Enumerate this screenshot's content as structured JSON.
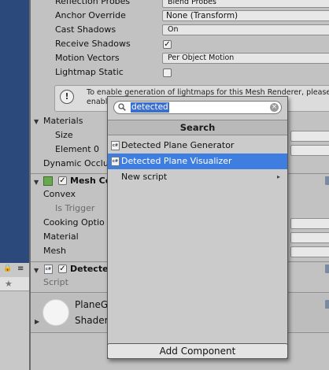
{
  "inspector": {
    "props": {
      "reflection_probes_label": "Reflection Probes",
      "reflection_probes_value": "Blend Probes",
      "anchor_override_label": "Anchor Override",
      "anchor_override_value": "None (Transform)",
      "cast_shadows_label": "Cast Shadows",
      "cast_shadows_value": "On",
      "receive_shadows_label": "Receive Shadows",
      "receive_shadows_mark": "✓",
      "motion_vectors_label": "Motion Vectors",
      "motion_vectors_value": "Per Object Motion",
      "lightmap_static_label": "Lightmap Static"
    },
    "info_text": "To enable generation of lightmaps for this Mesh Renderer, please enable",
    "materials": {
      "header": "Materials",
      "size_label": "Size",
      "element0_label": "Element 0"
    },
    "dynamic_occlusion_label": "Dynamic Occlu",
    "mesh_collider": {
      "title": "Mesh Co",
      "check_mark": "✓",
      "convex_label": "Convex",
      "is_trigger_label": "Is Trigger",
      "cooking_options_label": "Cooking Optio",
      "material_label": "Material",
      "mesh_label": "Mesh"
    },
    "detected_component": {
      "title": "Detecte",
      "check_mark": "✓",
      "script_label": "Script",
      "script_icon_text": "c#"
    },
    "material_preview": {
      "name": "PlaneG",
      "shader_label": "Shader"
    }
  },
  "popup": {
    "search_value": "detected",
    "header": "Search",
    "items": [
      {
        "label": "Detected Plane Generator",
        "icon": "c#"
      },
      {
        "label": "Detected Plane Visualizer",
        "icon": "c#"
      },
      {
        "label": "New script"
      }
    ],
    "submenu_arrow": "▸",
    "clear_glyph": "×"
  },
  "add_component_label": "Add Component",
  "left_panel": {
    "lock_glyph": "🔒",
    "menu_glyph": "≡",
    "star_glyph": "★"
  },
  "colors": {
    "selection_blue": "#3e7ee0",
    "scene_blue": "#2b4a7b",
    "inspector_bg": "#c2c2c2"
  }
}
